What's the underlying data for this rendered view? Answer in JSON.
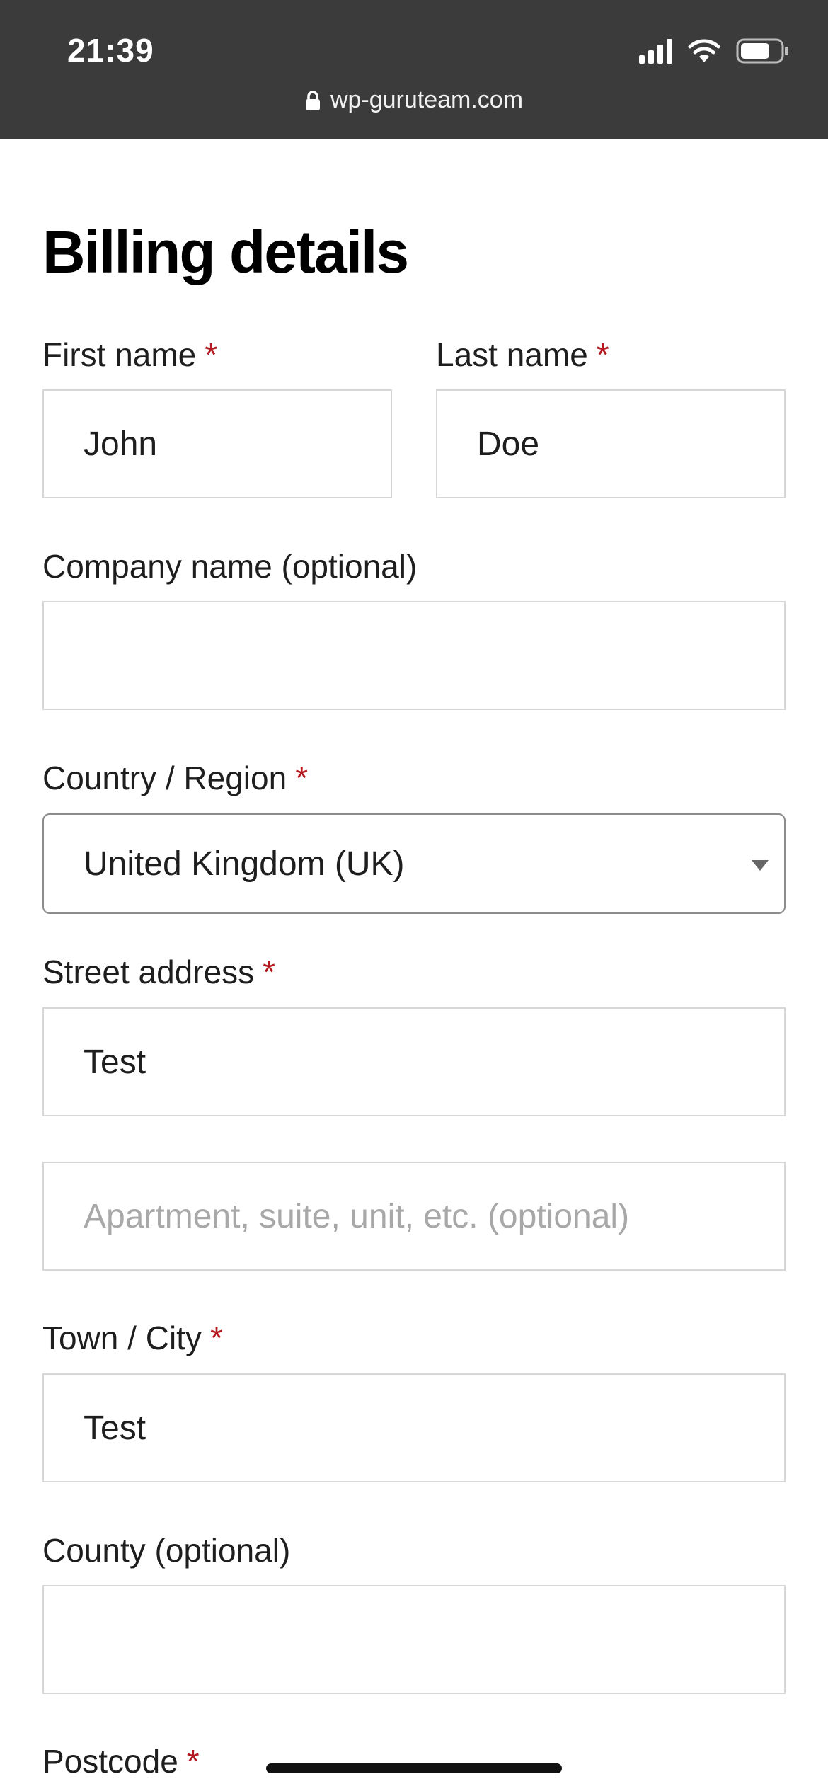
{
  "status_bar": {
    "time": "21:39",
    "url": "wp-guruteam.com",
    "icons": [
      "signal-icon",
      "wifi-icon",
      "battery-icon",
      "lock-icon"
    ]
  },
  "form": {
    "title": "Billing details",
    "required_marker": "*",
    "first_name": {
      "label": "First name",
      "value": "John"
    },
    "last_name": {
      "label": "Last name",
      "value": "Doe"
    },
    "company": {
      "label": "Company name (optional)",
      "value": ""
    },
    "country": {
      "label": "Country / Region",
      "selected": "United Kingdom (UK)"
    },
    "street": {
      "label": "Street address",
      "value": "Test",
      "placeholder_line2": "Apartment, suite, unit, etc. (optional)"
    },
    "city": {
      "label": "Town / City",
      "value": "Test"
    },
    "county": {
      "label": "County (optional)",
      "value": ""
    },
    "postcode": {
      "label": "Postcode"
    }
  },
  "colors": {
    "status_bar_bg": "#3b3b3b",
    "required": "#b3171f",
    "input_border": "#d7d7d7"
  }
}
